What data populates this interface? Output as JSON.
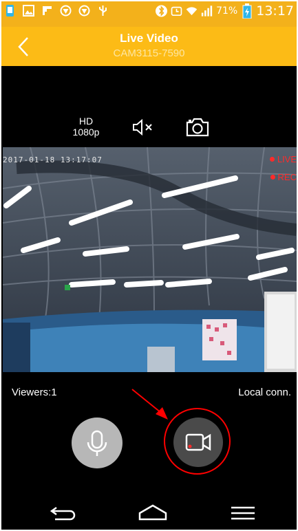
{
  "status_bar": {
    "battery_percent": "71%",
    "time": "13:17",
    "icons": [
      "notification-icon",
      "gallery-icon",
      "flipboard-icon",
      "shield-icon",
      "shield-icon",
      "usb-icon",
      "bluetooth-icon",
      "alarm-icon",
      "wifi-icon",
      "signal-icon",
      "battery-icon"
    ]
  },
  "header": {
    "title": "Live Video",
    "subtitle": "CAM3115-7590",
    "background": "#fcbb16"
  },
  "controls": {
    "quality_line1": "HD",
    "quality_line2": "1080p"
  },
  "video": {
    "timestamp": "2017-01-18 13:17:07",
    "live_label": "LIVE",
    "rec_label": "REC"
  },
  "info": {
    "viewers": "Viewers:1",
    "connection": "Local conn."
  },
  "colors": {
    "accent": "#fcbb16",
    "indicator_red": "#ff2a2a",
    "highlight_red": "#ff0000"
  }
}
